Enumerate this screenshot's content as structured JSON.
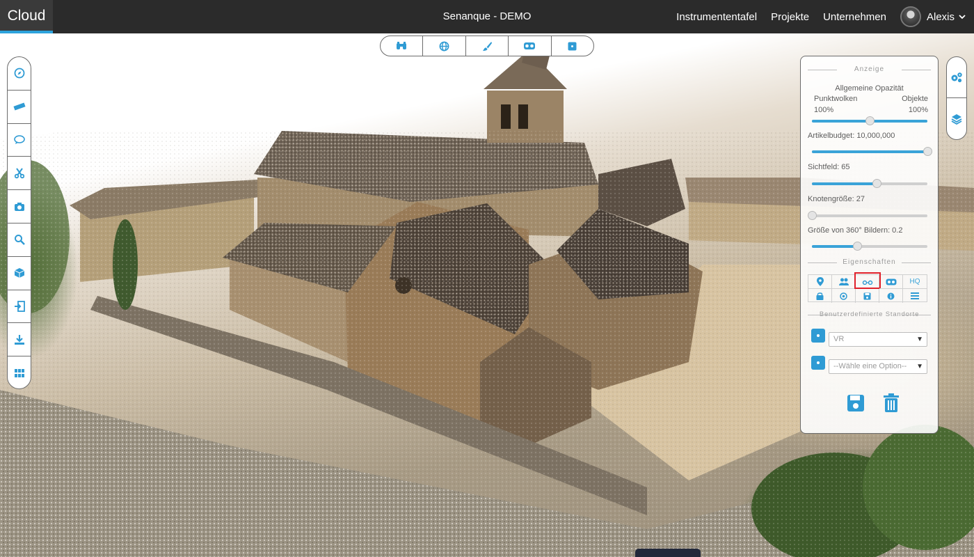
{
  "app": {
    "brand": "Cloud",
    "project_title": "Senanque - DEMO"
  },
  "nav": {
    "links": [
      "Instrumententafel",
      "Projekte",
      "Unternehmen"
    ],
    "user_name": "Alexis"
  },
  "toolbar_top": {
    "icons": [
      "binoculars-icon",
      "globe-icon",
      "brush-icon",
      "vr-goggles-icon",
      "square-icon"
    ]
  },
  "toolbar_left": {
    "icons": [
      "compass-icon",
      "ruler-icon",
      "comment-icon",
      "scissors-icon",
      "camera-icon",
      "search-icon",
      "cube-icon",
      "import-icon",
      "download-icon",
      "grid-icon"
    ]
  },
  "toolbar_right": {
    "icons": [
      "settings-gears-icon",
      "layers-icon"
    ]
  },
  "panel": {
    "display_title": "Anzeige",
    "opacity": {
      "title": "Allgemeine Opazität",
      "pointclouds_label": "Punktwolken",
      "objects_label": "Objekte",
      "pointclouds_value": "100%",
      "objects_value": "100%",
      "fraction": 0.5
    },
    "budget": {
      "label": "Artikelbudget: 10,000,000",
      "fraction": 1.0
    },
    "fov": {
      "label": "Sichtfeld: 65",
      "fraction": 0.56
    },
    "node_size": {
      "label": "Knotengröße: 27",
      "fraction": 0.0
    },
    "image360_size": {
      "label": "Größe von 360° Bildern: 0.2",
      "fraction": 0.39
    },
    "properties_title": "Eigenschaften",
    "properties": {
      "icons": [
        "marker-icon",
        "users-icon",
        "glasses-icon",
        "vr-icon",
        "hq-label",
        "lock-icon",
        "target-icon",
        "floppy-icon",
        "info-icon",
        "list-icon"
      ],
      "hq_label": "HQ",
      "selected": "glasses-icon"
    },
    "custom_locations_title": "Benutzerdefinierte Standorte",
    "location_select_1": "VR",
    "location_select_2": "--Wähle eine Option--"
  },
  "colors": {
    "accent": "#2da3dc",
    "topbar": "#2b2b2b",
    "highlight": "#e0202a"
  }
}
